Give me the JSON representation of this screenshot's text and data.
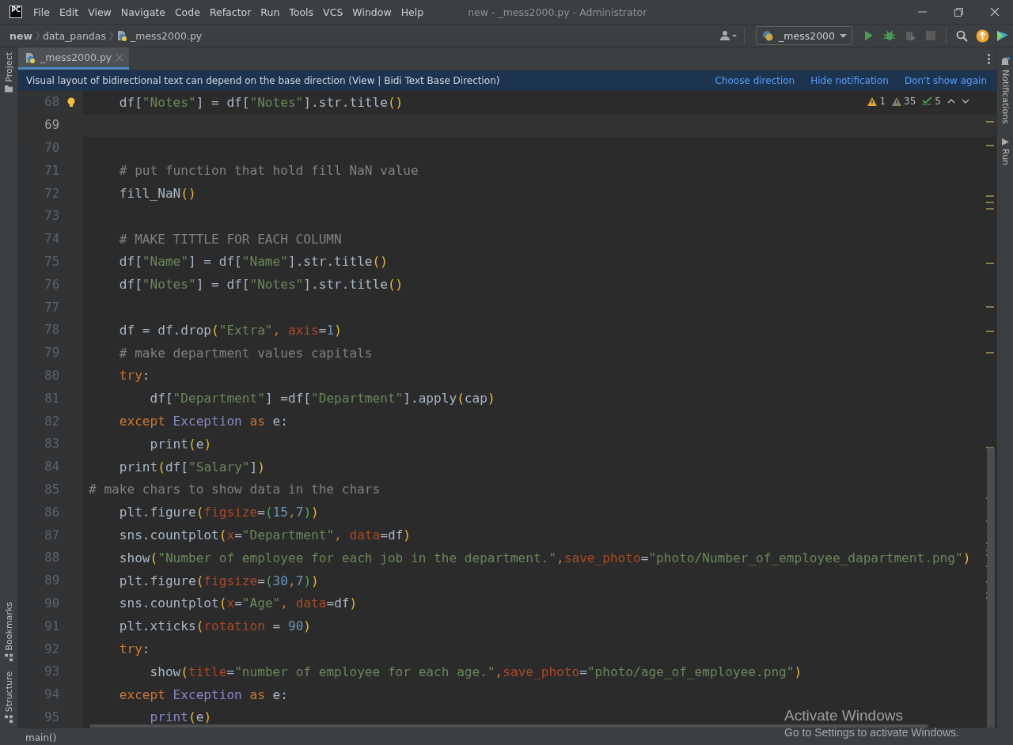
{
  "window": {
    "logo": "PC",
    "title": "new - _mess2000.py - Administrator"
  },
  "menu": [
    "File",
    "Edit",
    "View",
    "Navigate",
    "Code",
    "Refactor",
    "Run",
    "Tools",
    "VCS",
    "Window",
    "Help"
  ],
  "breadcrumbs": [
    {
      "label": "new",
      "kind": "root"
    },
    {
      "label": "data_pandas",
      "kind": "folder"
    },
    {
      "label": "_mess2000.py",
      "kind": "file"
    }
  ],
  "run_config": {
    "label": "_mess2000"
  },
  "left_tools": {
    "top": [
      {
        "label": "Project"
      }
    ],
    "bottom": [
      {
        "label": "Bookmarks"
      },
      {
        "label": "Structure"
      }
    ]
  },
  "right_tools": [
    {
      "label": "Notifications"
    },
    {
      "label": "Run"
    }
  ],
  "tabs": [
    {
      "label": "_mess2000.py",
      "selected": true
    }
  ],
  "banner": {
    "text": "Visual layout of bidirectional text can depend on the base direction (View | Bidi Text Base Direction)",
    "actions": [
      "Choose direction",
      "Hide notification",
      "Don't show again"
    ]
  },
  "inspections": [
    {
      "kind": "warning",
      "count": "1"
    },
    {
      "kind": "weak",
      "count": "35"
    },
    {
      "kind": "typo",
      "count": "5"
    }
  ],
  "lines": [
    {
      "number": "68",
      "current": false,
      "bulb": true,
      "tokens": [
        {
          "kind": "p",
          "text": "    df["
        },
        {
          "kind": "s",
          "text": "\"Notes\""
        },
        {
          "kind": "p",
          "text": "] = df["
        },
        {
          "kind": "s",
          "text": "\"Notes\""
        },
        {
          "kind": "p",
          "text": "].str.title"
        },
        {
          "kind": "y",
          "text": "()"
        }
      ]
    },
    {
      "number": "69",
      "current": true
    },
    {
      "number": "70",
      "current": false
    },
    {
      "number": "71",
      "current": false,
      "tokens": [
        {
          "kind": "c",
          "text": "    # put function that hold fill NaN value"
        }
      ]
    },
    {
      "number": "72",
      "current": false,
      "tokens": [
        {
          "kind": "p",
          "text": "    fill_NaN"
        },
        {
          "kind": "y",
          "text": "()"
        }
      ]
    },
    {
      "number": "73",
      "current": false
    },
    {
      "number": "74",
      "current": false,
      "tokens": [
        {
          "kind": "c",
          "text": "    # MAKE TITTLE FOR EACH COLUMN"
        }
      ]
    },
    {
      "number": "75",
      "current": false,
      "tokens": [
        {
          "kind": "p",
          "text": "    df["
        },
        {
          "kind": "s",
          "text": "\"Name\""
        },
        {
          "kind": "p",
          "text": "] = df["
        },
        {
          "kind": "s",
          "text": "\"Name\""
        },
        {
          "kind": "p",
          "text": "].str.title"
        },
        {
          "kind": "y",
          "text": "()"
        }
      ]
    },
    {
      "number": "76",
      "current": false,
      "tokens": [
        {
          "kind": "p",
          "text": "    df["
        },
        {
          "kind": "s",
          "text": "\"Notes\""
        },
        {
          "kind": "p",
          "text": "] = df["
        },
        {
          "kind": "s",
          "text": "\"Notes\""
        },
        {
          "kind": "p",
          "text": "].str.title"
        },
        {
          "kind": "y",
          "text": "()"
        }
      ]
    },
    {
      "number": "77",
      "current": false
    },
    {
      "number": "78",
      "current": false,
      "tokens": [
        {
          "kind": "p",
          "text": "    df = df.drop"
        },
        {
          "kind": "y",
          "text": "("
        },
        {
          "kind": "s",
          "text": "\"Extra\""
        },
        {
          "kind": "k",
          "text": ", "
        },
        {
          "kind": "a",
          "text": "axis"
        },
        {
          "kind": "p",
          "text": "="
        },
        {
          "kind": "n",
          "text": "1"
        },
        {
          "kind": "y",
          "text": ")"
        }
      ]
    },
    {
      "number": "79",
      "current": false,
      "tokens": [
        {
          "kind": "c",
          "text": "    # make department values capitals"
        }
      ]
    },
    {
      "number": "80",
      "current": false,
      "tokens": [
        {
          "kind": "k",
          "text": "    try"
        },
        {
          "kind": "p",
          "text": ":"
        }
      ]
    },
    {
      "number": "81",
      "current": false,
      "tokens": [
        {
          "kind": "p",
          "text": "        df["
        },
        {
          "kind": "s",
          "text": "\"Department\""
        },
        {
          "kind": "p",
          "text": "] =df["
        },
        {
          "kind": "s",
          "text": "\"Department\""
        },
        {
          "kind": "p",
          "text": "].apply"
        },
        {
          "kind": "y",
          "text": "("
        },
        {
          "kind": "p",
          "text": "cap"
        },
        {
          "kind": "y",
          "text": ")"
        }
      ]
    },
    {
      "number": "82",
      "current": false,
      "tokens": [
        {
          "kind": "k",
          "text": "    except "
        },
        {
          "kind": "t",
          "text": "Exception"
        },
        {
          "kind": "k",
          "text": " as "
        },
        {
          "kind": "p",
          "text": "e:"
        }
      ]
    },
    {
      "number": "83",
      "current": false,
      "tokens": [
        {
          "kind": "p",
          "text": "        print"
        },
        {
          "kind": "y",
          "text": "("
        },
        {
          "kind": "p",
          "text": "e"
        },
        {
          "kind": "y",
          "text": ")"
        }
      ]
    },
    {
      "number": "84",
      "current": false,
      "tokens": [
        {
          "kind": "p",
          "text": "    print"
        },
        {
          "kind": "y",
          "text": "("
        },
        {
          "kind": "p",
          "text": "df["
        },
        {
          "kind": "s",
          "text": "\"Salary\""
        },
        {
          "kind": "p",
          "text": "]"
        },
        {
          "kind": "y",
          "text": ")"
        }
      ]
    },
    {
      "number": "85",
      "current": false,
      "tokens": [
        {
          "kind": "c",
          "text": "# make chars to show data in the chars"
        }
      ]
    },
    {
      "number": "86",
      "current": false,
      "tokens": [
        {
          "kind": "p",
          "text": "    plt.figure"
        },
        {
          "kind": "y",
          "text": "("
        },
        {
          "kind": "a",
          "text": "figsize"
        },
        {
          "kind": "p",
          "text": "="
        },
        {
          "kind": "g",
          "text": "("
        },
        {
          "kind": "n",
          "text": "15"
        },
        {
          "kind": "k",
          "text": ","
        },
        {
          "kind": "n",
          "text": "7"
        },
        {
          "kind": "g",
          "text": ")"
        },
        {
          "kind": "y",
          "text": ")"
        }
      ]
    },
    {
      "number": "87",
      "current": false,
      "tokens": [
        {
          "kind": "p",
          "text": "    sns.countplot"
        },
        {
          "kind": "y",
          "text": "("
        },
        {
          "kind": "a",
          "text": "x"
        },
        {
          "kind": "p",
          "text": "="
        },
        {
          "kind": "s",
          "text": "\"Department\""
        },
        {
          "kind": "k",
          "text": ", "
        },
        {
          "kind": "a",
          "text": "data"
        },
        {
          "kind": "p",
          "text": "=df"
        },
        {
          "kind": "y",
          "text": ")"
        }
      ]
    },
    {
      "number": "88",
      "current": false,
      "tokens": [
        {
          "kind": "p",
          "text": "    show"
        },
        {
          "kind": "y",
          "text": "("
        },
        {
          "kind": "s",
          "text": "\"Number of employee for each job in the department.\""
        },
        {
          "kind": "k",
          "text": ","
        },
        {
          "kind": "a",
          "text": "save_photo"
        },
        {
          "kind": "p",
          "text": "="
        },
        {
          "kind": "s",
          "text": "\"photo/Number_of_employee_dapartment.png\""
        },
        {
          "kind": "y",
          "text": ")"
        }
      ]
    },
    {
      "number": "89",
      "current": false,
      "tokens": [
        {
          "kind": "p",
          "text": "    plt.figure"
        },
        {
          "kind": "y",
          "text": "("
        },
        {
          "kind": "a",
          "text": "figsize"
        },
        {
          "kind": "p",
          "text": "="
        },
        {
          "kind": "g",
          "text": "("
        },
        {
          "kind": "n",
          "text": "30"
        },
        {
          "kind": "k",
          "text": ","
        },
        {
          "kind": "n",
          "text": "7"
        },
        {
          "kind": "g",
          "text": ")"
        },
        {
          "kind": "y",
          "text": ")"
        }
      ]
    },
    {
      "number": "90",
      "current": false,
      "tokens": [
        {
          "kind": "p",
          "text": "    sns.countplot"
        },
        {
          "kind": "y",
          "text": "("
        },
        {
          "kind": "a",
          "text": "x"
        },
        {
          "kind": "p",
          "text": "="
        },
        {
          "kind": "s",
          "text": "\"Age\""
        },
        {
          "kind": "k",
          "text": ", "
        },
        {
          "kind": "a",
          "text": "data"
        },
        {
          "kind": "p",
          "text": "=df"
        },
        {
          "kind": "y",
          "text": ")"
        }
      ]
    },
    {
      "number": "91",
      "current": false,
      "tokens": [
        {
          "kind": "p",
          "text": "    plt.xticks"
        },
        {
          "kind": "y",
          "text": "("
        },
        {
          "kind": "a",
          "text": "rotation"
        },
        {
          "kind": "p",
          "text": " = "
        },
        {
          "kind": "n",
          "text": "90"
        },
        {
          "kind": "y",
          "text": ")"
        }
      ]
    },
    {
      "number": "92",
      "current": false,
      "tokens": [
        {
          "kind": "k",
          "text": "    try"
        },
        {
          "kind": "p",
          "text": ":"
        }
      ]
    },
    {
      "number": "93",
      "current": false,
      "tokens": [
        {
          "kind": "p",
          "text": "        show"
        },
        {
          "kind": "y",
          "text": "("
        },
        {
          "kind": "a",
          "text": "title"
        },
        {
          "kind": "p",
          "text": "="
        },
        {
          "kind": "s",
          "text": "\"number of employee for each age.\""
        },
        {
          "kind": "k",
          "text": ","
        },
        {
          "kind": "a",
          "text": "save_photo"
        },
        {
          "kind": "p",
          "text": "="
        },
        {
          "kind": "s",
          "text": "\"photo/age_of_employee.png\""
        },
        {
          "kind": "y",
          "text": ")"
        }
      ]
    },
    {
      "number": "94",
      "current": false,
      "tokens": [
        {
          "kind": "k",
          "text": "    except "
        },
        {
          "kind": "t",
          "text": "Exception"
        },
        {
          "kind": "k",
          "text": " as "
        },
        {
          "kind": "p",
          "text": "e:"
        }
      ]
    },
    {
      "number": "95",
      "current": false,
      "tokens": [
        {
          "kind": "t",
          "text": "        print"
        },
        {
          "kind": "y",
          "text": "("
        },
        {
          "kind": "p",
          "text": "e"
        },
        {
          "kind": "y",
          "text": ")"
        }
      ]
    }
  ],
  "status_bar": {
    "breadcrumb": "main()"
  },
  "os_overlay": {
    "title": "Activate Windows",
    "subtitle": "Go to Settings to activate Windows."
  }
}
